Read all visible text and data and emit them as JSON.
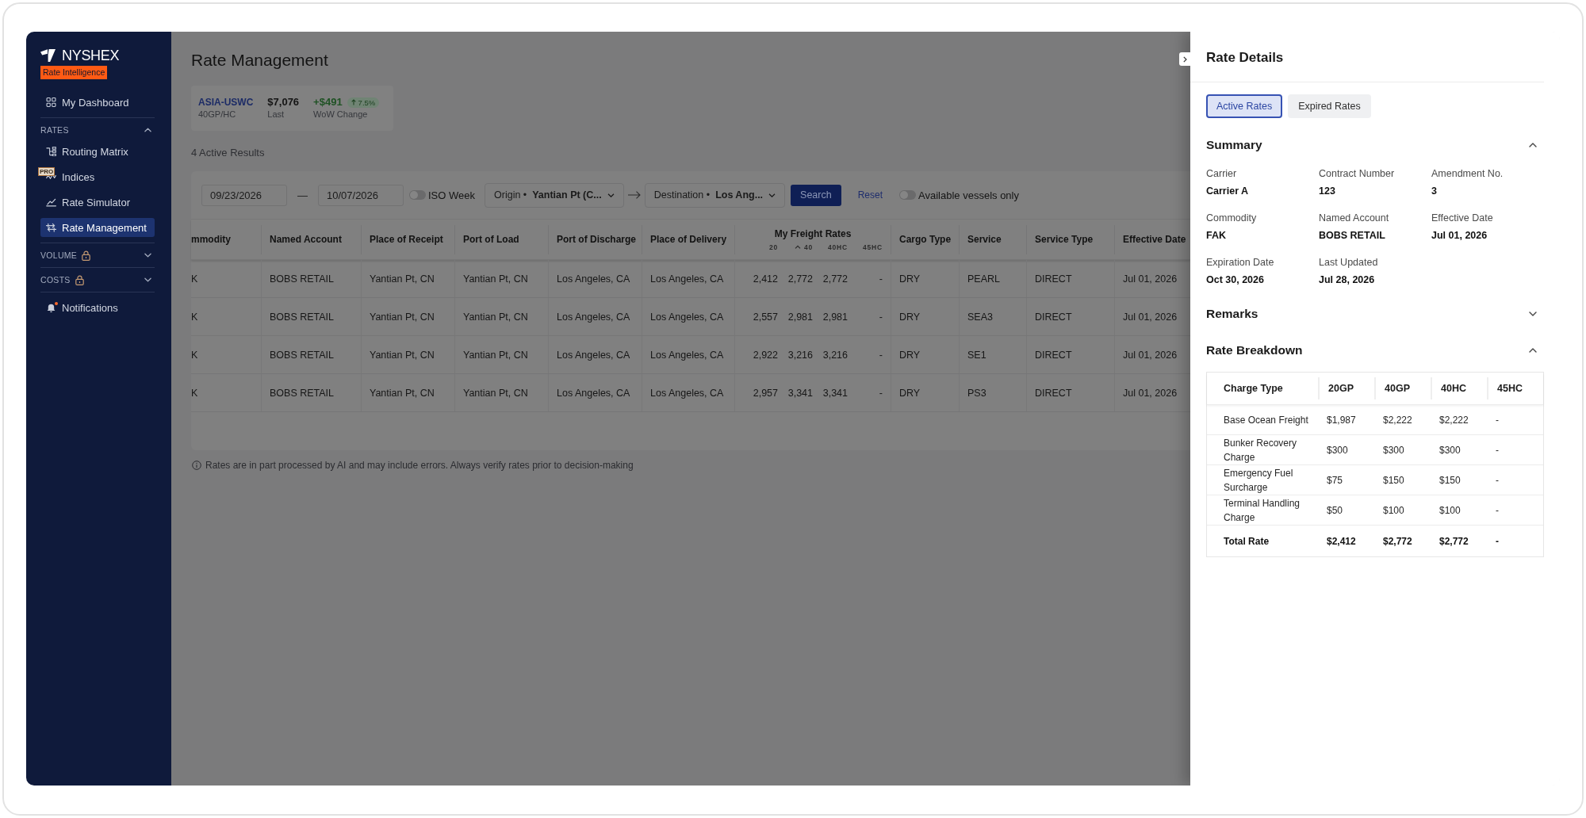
{
  "sidebar": {
    "brand": "NYSHEX",
    "product": "Rate Intelligence",
    "nav": [
      {
        "kind": "link",
        "label": "My Dashboard",
        "selected": false,
        "unread": false
      },
      {
        "kind": "group",
        "label": "RATES",
        "expanded": true,
        "locked": false,
        "children": [
          {
            "label": "Routing Matrix",
            "selected": false
          },
          {
            "label": "Indices",
            "badge": "PRO",
            "selected": false
          },
          {
            "label": "Rate Simulator",
            "selected": false
          },
          {
            "label": "Rate Management",
            "selected": true
          }
        ]
      },
      {
        "kind": "group",
        "label": "VOLUME",
        "expanded": false,
        "locked": true
      },
      {
        "kind": "group",
        "label": "COSTS",
        "expanded": false,
        "locked": true
      },
      {
        "kind": "link",
        "label": "Notifications",
        "selected": false,
        "unread": true
      }
    ]
  },
  "page": {
    "title": "Rate Management"
  },
  "stat": {
    "lane": "ASIA-USWC",
    "equipment": "40GP/HC",
    "price": "$7,076",
    "price_label": "Last",
    "change": "+$491",
    "rising": true,
    "change_pct": "7.5%",
    "change_label": "WoW Change"
  },
  "results_count": "4 Active Results",
  "filters": {
    "date_from": "09/23/2026",
    "separator": "—",
    "date_to": "10/07/2026",
    "iso_week": {
      "label": "ISO Week",
      "on": false
    },
    "origin": "Origin • **Yantian Pt (C...**",
    "destination": "Destination • **Los Ang...**",
    "search": "Search",
    "reset": "Reset",
    "available_vessels": {
      "label": "Available vessels only",
      "on": false
    }
  },
  "table": {
    "columns": [
      {
        "kind": "text",
        "label": "mmodity"
      },
      {
        "kind": "text",
        "label": "Named Account"
      },
      {
        "kind": "text",
        "label": "Place of Receipt"
      },
      {
        "kind": "text",
        "label": "Port of Load"
      },
      {
        "kind": "text",
        "label": "Port of Discharge"
      },
      {
        "kind": "text",
        "label": "Place of Delivery"
      },
      {
        "kind": "rates",
        "label": "My Freight Rates",
        "sub": [
          {
            "label": "20",
            "sorted": false
          },
          {
            "label": "40",
            "sorted": true
          },
          {
            "label": "40HC",
            "sorted": false
          },
          {
            "label": "45HC",
            "sorted": false
          }
        ]
      },
      {
        "kind": "text",
        "label": "Cargo Type"
      },
      {
        "kind": "text",
        "label": "Service"
      },
      {
        "kind": "text",
        "label": "Service Type"
      },
      {
        "kind": "text",
        "label": "Effective Date"
      }
    ],
    "rows": [
      {
        "cells": [
          "K",
          "BOBS RETAIL",
          "Yantian Pt, CN",
          "Yantian Pt, CN",
          "Los Angeles, CA",
          "Los Angeles, CA",
          [
            "2,412",
            "2,772",
            "2,772",
            "-"
          ],
          "DRY",
          "PEARL",
          "DIRECT",
          "Jul 01, 2026"
        ]
      },
      {
        "cells": [
          "K",
          "BOBS RETAIL",
          "Yantian Pt, CN",
          "Yantian Pt, CN",
          "Los Angeles, CA",
          "Los Angeles, CA",
          [
            "2,557",
            "2,981",
            "2,981",
            "-"
          ],
          "DRY",
          "SEA3",
          "DIRECT",
          "Jul 01, 2026"
        ]
      },
      {
        "cells": [
          "K",
          "BOBS RETAIL",
          "Yantian Pt, CN",
          "Yantian Pt, CN",
          "Los Angeles, CA",
          "Los Angeles, CA",
          [
            "2,922",
            "3,216",
            "3,216",
            "-"
          ],
          "DRY",
          "SE1",
          "DIRECT",
          "Jul 01, 2026"
        ]
      },
      {
        "cells": [
          "K",
          "BOBS RETAIL",
          "Yantian Pt, CN",
          "Yantian Pt, CN",
          "Los Angeles, CA",
          "Los Angeles, CA",
          [
            "2,957",
            "3,341",
            "3,341",
            "-"
          ],
          "DRY",
          "PS3",
          "DIRECT",
          "Jul 01, 2026"
        ]
      }
    ]
  },
  "disclaimer": "Rates are in part processed by AI and may include errors. Always verify rates prior to decision-making",
  "details": {
    "title": "Rate Details",
    "tabs": [
      {
        "label": "Active Rates",
        "selected": true
      },
      {
        "label": "Expired Rates",
        "selected": false
      }
    ],
    "sections": [
      {
        "kind": "fields",
        "title": "Summary",
        "expanded": true,
        "fields": [
          {
            "label": "Carrier",
            "value": "Carrier A"
          },
          {
            "label": "Contract Number",
            "value": "123"
          },
          {
            "label": "Amendment No.",
            "value": "3"
          },
          {
            "label": "Commodity",
            "value": "FAK"
          },
          {
            "label": "Named Account",
            "value": "BOBS RETAIL"
          },
          {
            "label": "Effective Date",
            "value": "Jul 01, 2026"
          },
          {
            "label": "Expiration Date",
            "value": "Oct 30, 2026"
          },
          {
            "label": "Last Updated",
            "value": "Jul 28, 2026"
          }
        ]
      },
      {
        "title": "Remarks",
        "expanded": false
      },
      {
        "kind": "table",
        "title": "Rate Breakdown",
        "expanded": true,
        "columns": [
          "Charge Type",
          "20GP",
          "40GP",
          "40HC",
          "45HC"
        ],
        "rows": [
          {
            "kind": "charge",
            "cells": [
              "Base Ocean Freight",
              "$1,987",
              "$2,222",
              "$2,222",
              "-"
            ]
          },
          {
            "kind": "charge",
            "cells": [
              "Bunker Recovery Charge",
              "$300",
              "$300",
              "$300",
              "-"
            ]
          },
          {
            "kind": "charge",
            "cells": [
              "Emergency Fuel Surcharge",
              "$75",
              "$150",
              "$150",
              "-"
            ]
          },
          {
            "kind": "charge",
            "cells": [
              "Terminal Handling Charge",
              "$50",
              "$100",
              "$100",
              "-"
            ]
          },
          {
            "kind": "total",
            "cells": [
              "Total Rate",
              "$2,412",
              "$2,772",
              "$2,772",
              "-"
            ]
          }
        ]
      }
    ]
  }
}
